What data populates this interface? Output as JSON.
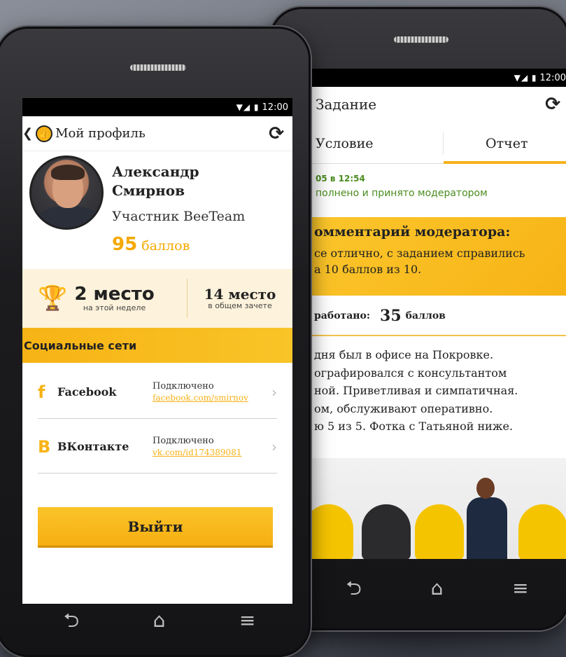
{
  "status_bar": {
    "time": "12:00",
    "icons": "wifi-signal-battery"
  },
  "task_screen": {
    "title": "Задание",
    "tabs": [
      {
        "label": "Условие",
        "active": false
      },
      {
        "label": "Отчет",
        "active": true
      }
    ],
    "date": "05 в 12:54",
    "status": "полнено и принято модератором",
    "moderator": {
      "title": "омментарий модератора:",
      "text_line1": "се отлично, с заданием справились",
      "text_line2": "а 10 баллов из 10."
    },
    "earned_label": "работано:",
    "earned_value": "35",
    "earned_unit": "баллов",
    "report_lines": [
      "дня был в офисе на Покровке.",
      "ографировался с консультантом",
      "ной. Приветливая и симпатичная.",
      "ом, обслуживают оперативно.",
      "ю 5 из 5. Фотка с Татьяной ниже."
    ]
  },
  "profile_screen": {
    "title": "Мой профиль",
    "user": {
      "first_name": "Александр",
      "last_name": "Смирнов",
      "role": "Участник BeeTeam",
      "points_value": "95",
      "points_unit": "баллов"
    },
    "rank_week": {
      "place": "2 место",
      "caption": "на этой неделе"
    },
    "rank_total": {
      "place": "14 место",
      "caption": "в общем зачете"
    },
    "social_title": "Социальные сети",
    "social": [
      {
        "icon": "f",
        "name": "Facebook",
        "status": "Подключено",
        "link": "facebook.com/smirnov"
      },
      {
        "icon": "В",
        "name": "ВКонтакте",
        "status": "Подключено",
        "link": "vk.com/id174389081"
      }
    ],
    "logout_label": "Выйти"
  },
  "colors": {
    "accent": "#f7b315",
    "accent_light": "#fdf2db",
    "success": "#4a8c1f"
  }
}
